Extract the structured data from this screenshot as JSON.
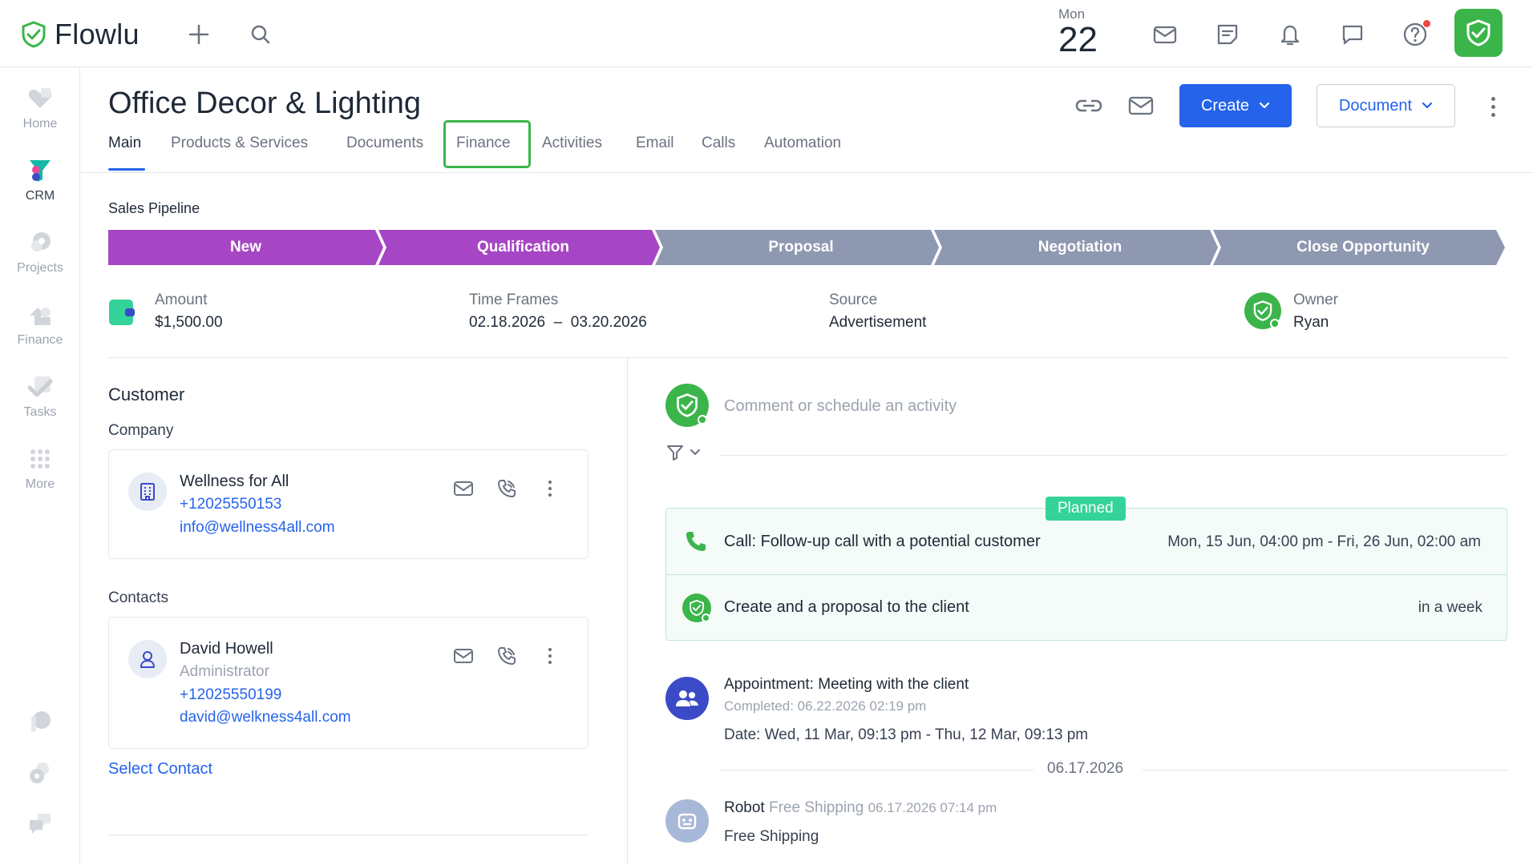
{
  "app": {
    "name": "Flowlu"
  },
  "topbar": {
    "date_dow": "Mon",
    "date_day": "22"
  },
  "sidebar": {
    "items": [
      {
        "label": "Home",
        "icon": "heart-icon"
      },
      {
        "label": "CRM",
        "icon": "funnel-icon"
      },
      {
        "label": "Projects",
        "icon": "projects-icon"
      },
      {
        "label": "Finance",
        "icon": "finance-icon"
      },
      {
        "label": "Tasks",
        "icon": "check-icon"
      },
      {
        "label": "More",
        "icon": "grid-icon"
      }
    ]
  },
  "header": {
    "title": "Office Decor & Lighting",
    "create_label": "Create",
    "document_label": "Document",
    "tabs": [
      "Main",
      "Products & Services",
      "Documents",
      "Finance",
      "Activities",
      "Email",
      "Calls",
      "Automation"
    ]
  },
  "pipeline": {
    "label": "Sales Pipeline",
    "stages": [
      "New",
      "Qualification",
      "Proposal",
      "Negotiation",
      "Close Opportunity"
    ],
    "colors": {
      "active": "#a646c4",
      "inactive": "#8e98b0"
    }
  },
  "meta": {
    "amount_label": "Amount",
    "amount_value": "$1,500.00",
    "timeframe_label": "Time Frames",
    "timeframe_value": "02.18.2026  –  03.20.2026",
    "source_label": "Source",
    "source_value": "Advertisement",
    "owner_label": "Owner",
    "owner_value": "Ryan"
  },
  "customer": {
    "title": "Customer",
    "company_label": "Company",
    "company": {
      "name": "Wellness for All",
      "phone": "+12025550153",
      "email": "info@wellness4all.com"
    },
    "contacts_label": "Contacts",
    "contact": {
      "name": "David Howell",
      "role": "Administrator",
      "phone": "+12025550199",
      "email": "david@welkness4all.com"
    },
    "select_contact": "Select Contact"
  },
  "activity": {
    "comment_placeholder": "Comment or schedule an activity",
    "planned_tag": "Planned",
    "planned": [
      {
        "text": "Call: Follow-up call with a potential customer",
        "date": "Mon, 15 Jun, 04:00 pm - Fri, 26 Jun, 02:00 am"
      },
      {
        "text": "Create and a proposal to the client",
        "date": "in a week"
      }
    ],
    "appointment": {
      "title": "Appointment: Meeting with the client",
      "completed": "Completed: 06.22.2026 02:19 pm",
      "date": "Date: Wed, 11 Mar, 09:13 pm - Thu, 12 Mar, 09:13 pm"
    },
    "date_separator": "06.17.2026",
    "robot": {
      "prefix": "Robot",
      "name": "Free Shipping",
      "time": "06.17.2026 07:14 pm",
      "text": "Free Shipping"
    }
  },
  "colors": {
    "brand_green": "#3bb54a",
    "primary_blue": "#2563eb",
    "planned_green": "#34d399"
  }
}
